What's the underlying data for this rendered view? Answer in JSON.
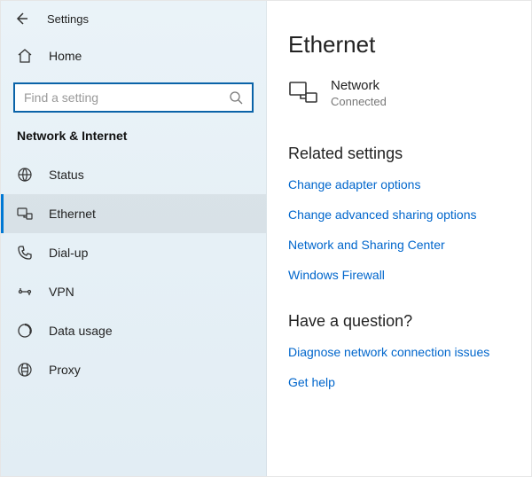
{
  "app_title": "Settings",
  "sidebar": {
    "home_label": "Home",
    "search_placeholder": "Find a setting",
    "category": "Network & Internet",
    "items": {
      "status": "Status",
      "ethernet": "Ethernet",
      "dialup": "Dial-up",
      "vpn": "VPN",
      "datausage": "Data usage",
      "proxy": "Proxy"
    }
  },
  "content": {
    "page_title": "Ethernet",
    "network_name": "Network",
    "network_status": "Connected",
    "related_header": "Related settings",
    "links": {
      "adapter": "Change adapter options",
      "sharing": "Change advanced sharing options",
      "center": "Network and Sharing Center",
      "firewall": "Windows Firewall"
    },
    "question_header": "Have a question?",
    "question_links": {
      "diagnose": "Diagnose network connection issues",
      "help": "Get help"
    }
  }
}
